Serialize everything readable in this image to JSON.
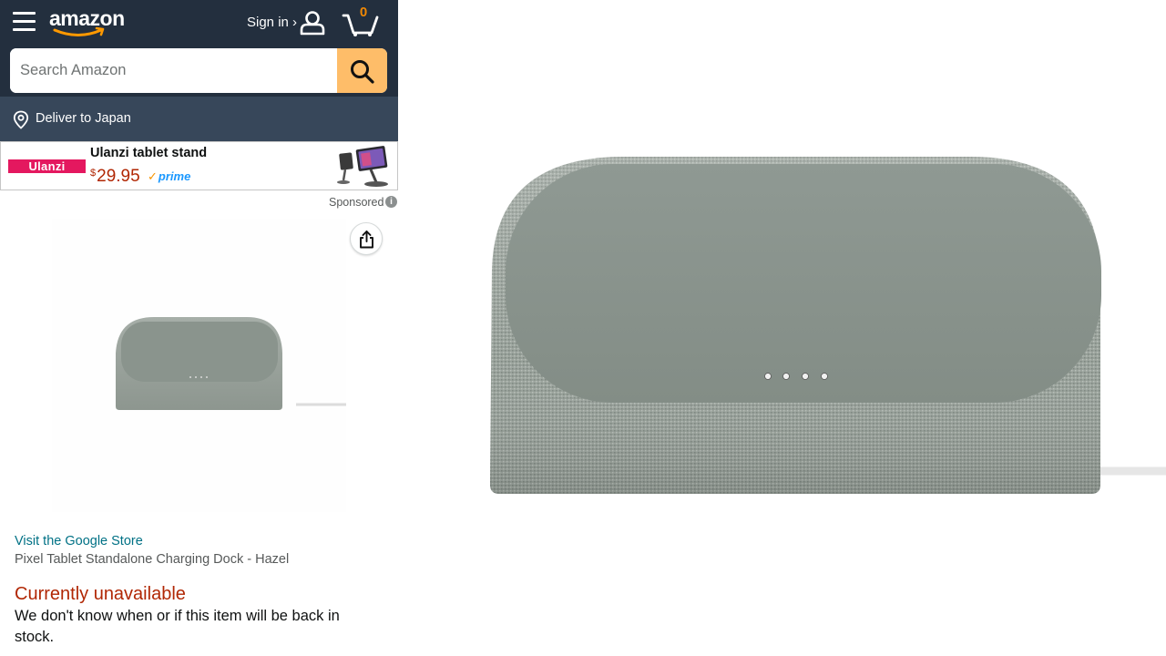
{
  "header": {
    "logo_text": "amazon",
    "sign_in_label": "Sign in ›",
    "cart_count": "0"
  },
  "search": {
    "placeholder": "Search Amazon",
    "value": ""
  },
  "delivery": {
    "label": "Deliver to Japan"
  },
  "sponsored_ad": {
    "brand": "Ulanzi",
    "title": "Ulanzi tablet stand",
    "currency": "$",
    "price": "29.95",
    "prime_label": "prime",
    "sponsored_label": "Sponsored",
    "info_glyph": "i"
  },
  "product": {
    "store_link": "Visit the Google Store",
    "title": "Pixel Tablet Standalone Charging Dock - Hazel",
    "availability": "Currently unavailable",
    "availability_message": "We don't know when or if this item will be back in stock."
  },
  "colors": {
    "header_bg": "#232f3e",
    "deliver_bg": "#37475a",
    "search_button": "#febd69",
    "link": "#007185",
    "unavailable": "#b12704",
    "prime_blue": "#1a98ff",
    "dock_color": "#8a958d"
  },
  "icons": {
    "menu": "hamburger-menu-icon",
    "account": "user-icon",
    "cart": "cart-icon",
    "search": "search-icon",
    "location": "location-pin-icon",
    "share": "share-icon",
    "info": "info-icon"
  }
}
